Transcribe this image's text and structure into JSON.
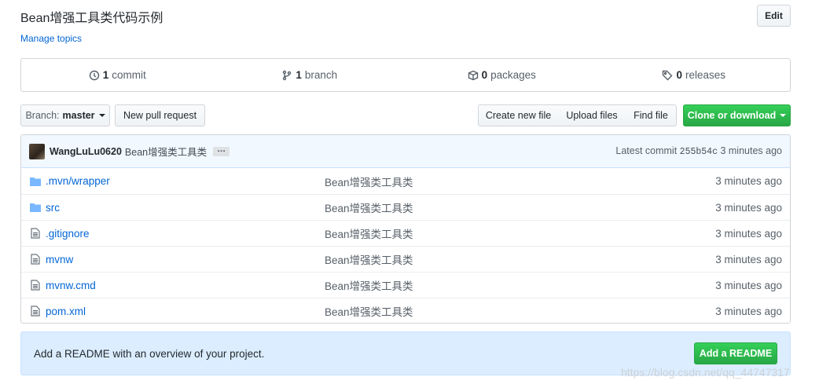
{
  "repo": {
    "description": "Bean增强工具类代码示例",
    "manage_topics": "Manage topics",
    "edit_label": "Edit"
  },
  "summary": [
    {
      "count": "1",
      "label": "commit",
      "icon": "commit-icon"
    },
    {
      "count": "1",
      "label": "branch",
      "icon": "branch-icon"
    },
    {
      "count": "0",
      "label": "packages",
      "icon": "package-icon"
    },
    {
      "count": "0",
      "label": "releases",
      "icon": "tag-icon"
    }
  ],
  "toolbar": {
    "branch_label": "Branch:",
    "branch_value": "master",
    "new_pr": "New pull request",
    "create_file": "Create new file",
    "upload_files": "Upload files",
    "find_file": "Find file",
    "clone": "Clone or download"
  },
  "commit": {
    "user": "WangLuLu0620",
    "message": "Bean增强类工具类",
    "ellipsis": "…",
    "latest_label": "Latest commit",
    "sha": "255b54c",
    "age": "3 minutes ago"
  },
  "files": [
    {
      "type": "folder",
      "name": ".mvn/wrapper",
      "message": "Bean增强类工具类",
      "age": "3 minutes ago"
    },
    {
      "type": "folder",
      "name": "src",
      "message": "Bean增强类工具类",
      "age": "3 minutes ago"
    },
    {
      "type": "file",
      "name": ".gitignore",
      "message": "Bean增强类工具类",
      "age": "3 minutes ago"
    },
    {
      "type": "file",
      "name": "mvnw",
      "message": "Bean增强类工具类",
      "age": "3 minutes ago"
    },
    {
      "type": "file",
      "name": "mvnw.cmd",
      "message": "Bean增强类工具类",
      "age": "3 minutes ago"
    },
    {
      "type": "file",
      "name": "pom.xml",
      "message": "Bean增强类工具类",
      "age": "3 minutes ago"
    }
  ],
  "readme": {
    "text": "Add a README with an overview of your project.",
    "button": "Add a README"
  },
  "watermark": "https://blog.csdn.net/qq_44747317",
  "colors": {
    "link": "#0366d6",
    "green": "#28a745",
    "border": "#d1d5da",
    "commit_bg": "#f1f8ff",
    "readme_bg": "#dbedff"
  }
}
